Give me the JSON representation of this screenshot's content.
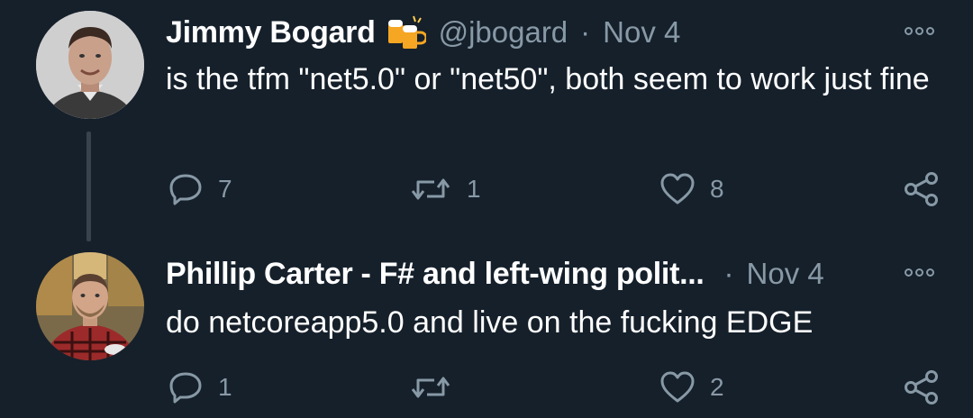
{
  "tweets": [
    {
      "display_name": "Jimmy Bogard",
      "badge_icon": "beer-mugs-emoji",
      "handle": "@jbogard",
      "separator": "·",
      "date": "Nov 4",
      "text": "is the tfm \"net5.0\" or \"net50\", both seem to work just fine",
      "actions": {
        "reply_count": "7",
        "retweet_count": "1",
        "like_count": "8"
      }
    },
    {
      "display_name": "Phillip Carter - F# and left-wing polit...",
      "separator": "·",
      "date": "Nov 4",
      "text": "do netcoreapp5.0 and live on the fucking EDGE",
      "actions": {
        "reply_count": "1",
        "retweet_count": "",
        "like_count": "2"
      }
    }
  ],
  "colors": {
    "background": "#15202b",
    "primary_text": "#ffffff",
    "secondary_text": "#8899a6",
    "thread_line": "#38444d"
  }
}
